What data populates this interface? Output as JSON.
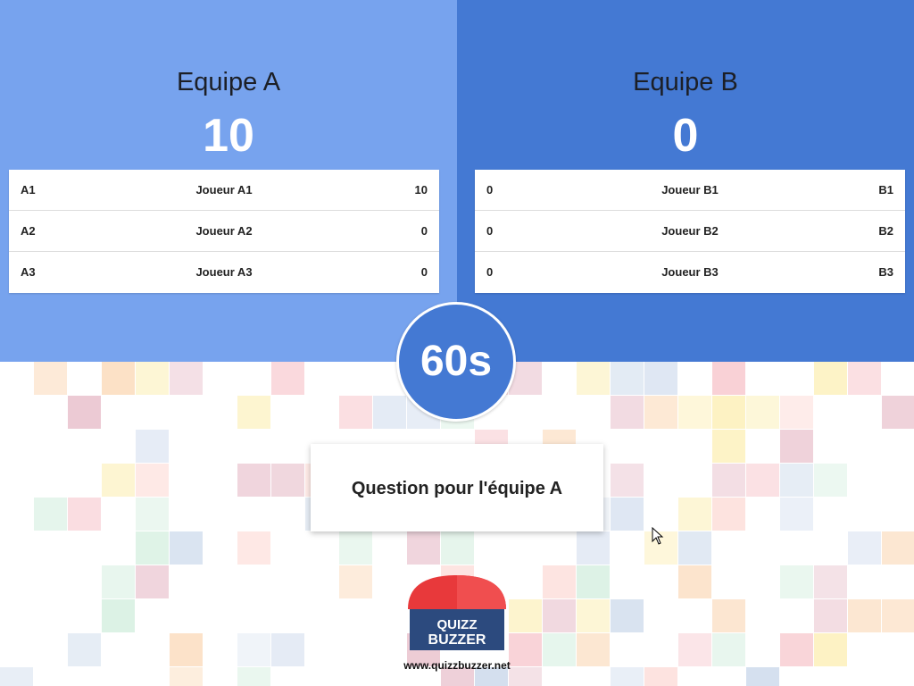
{
  "teams": [
    {
      "name": "Equipe A",
      "score": "10",
      "players": [
        {
          "id": "A1",
          "name": "Joueur A1",
          "score": "10"
        },
        {
          "id": "A2",
          "name": "Joueur A2",
          "score": "0"
        },
        {
          "id": "A3",
          "name": "Joueur A3",
          "score": "0"
        }
      ]
    },
    {
      "name": "Equipe B",
      "score": "0",
      "players": [
        {
          "id": "B1",
          "name": "Joueur B1",
          "score": "0"
        },
        {
          "id": "B2",
          "name": "Joueur B2",
          "score": "0"
        },
        {
          "id": "B3",
          "name": "Joueur B3",
          "score": "0"
        }
      ]
    }
  ],
  "timer": "60s",
  "question": "Question pour l'équipe A",
  "logo": {
    "line1": "QUIZZ",
    "line2": "BUZZER"
  },
  "site_url": "www.quizzbuzzer.net",
  "colors": {
    "team_a_bg": "#77a3ee",
    "team_b_bg": "#4479d3",
    "buzzer_red": "#e8393b",
    "logo_navy": "#2c4a7e"
  }
}
